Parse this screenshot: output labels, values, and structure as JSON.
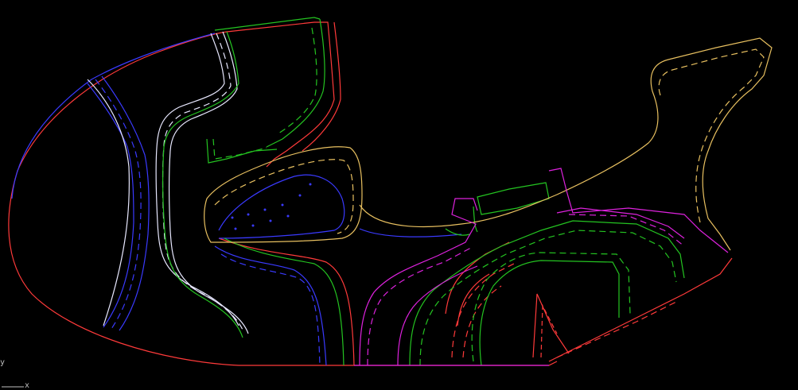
{
  "canvas": {
    "background": "#000000"
  },
  "axes": {
    "x_label": "x",
    "y_label": "y",
    "color": "#bfbfbf"
  },
  "layers": [
    {
      "name": "red",
      "color": "#ff2a2a"
    },
    {
      "name": "green",
      "color": "#22c21f"
    },
    {
      "name": "blue",
      "color": "#3434e6"
    },
    {
      "name": "white",
      "color": "#e8e8ff"
    },
    {
      "name": "yellow",
      "color": "#e8c060"
    },
    {
      "name": "magenta",
      "color": "#dd22dd"
    }
  ]
}
